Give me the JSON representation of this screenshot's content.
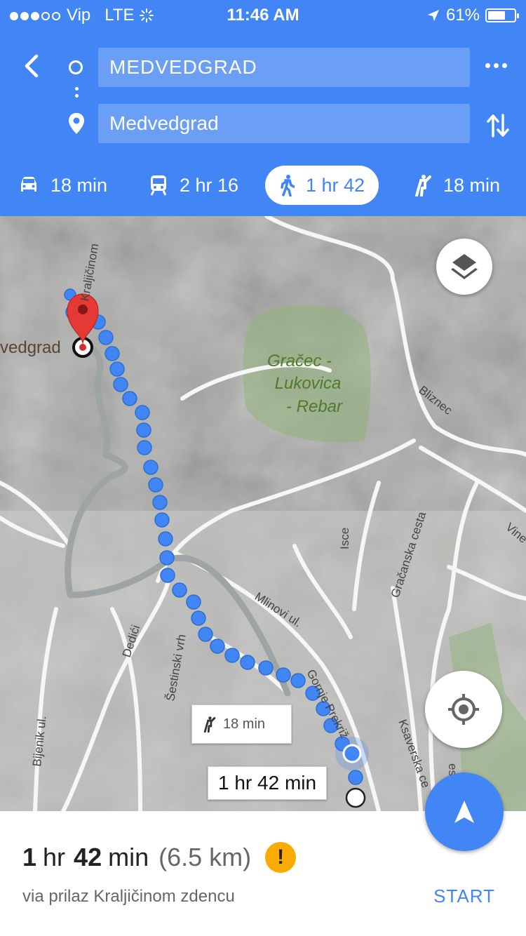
{
  "status_bar": {
    "carrier": "Vip",
    "network": "LTE",
    "time": "11:46 AM",
    "battery": "61%",
    "battery_level": 0.61
  },
  "directions": {
    "origin": "MEDVEDGRAD",
    "destination": "Medvedgrad",
    "modes": [
      {
        "icon": "car-icon",
        "label": "18 min"
      },
      {
        "icon": "train-icon",
        "label": "2 hr 16"
      },
      {
        "icon": "walk-icon",
        "label": "1 hr 42",
        "selected": true
      },
      {
        "icon": "ride-icon",
        "label": "18 min"
      }
    ]
  },
  "map": {
    "place_label": "vedgrad",
    "park_label": [
      "Gračec -",
      "Lukovica",
      "- Rebar"
    ],
    "streets": [
      "Kraljičinom",
      "Bliznec",
      "Gračanska cesta",
      "Isce",
      "Mlinovi ul.",
      "Dedići",
      "Šestinski vrh",
      "Gornje Prekriž",
      "Bijenik ul.",
      "Ksaverska ce",
      "Vine",
      "esta"
    ],
    "callout_ride": "18 min",
    "callout_walk": "1 hr 42 min"
  },
  "route": {
    "duration_hours": "1",
    "duration_hr_label": "hr",
    "duration_minutes": "42",
    "duration_min_label": "min",
    "distance": "(6.5 km)",
    "warning": "!",
    "via": "via prilaz Kraljičinom zdencu",
    "start_label": "START"
  },
  "colors": {
    "accent": "#4285f4",
    "warning": "#f9ab00",
    "pin": "#e53935",
    "park": "#8fb37a"
  }
}
